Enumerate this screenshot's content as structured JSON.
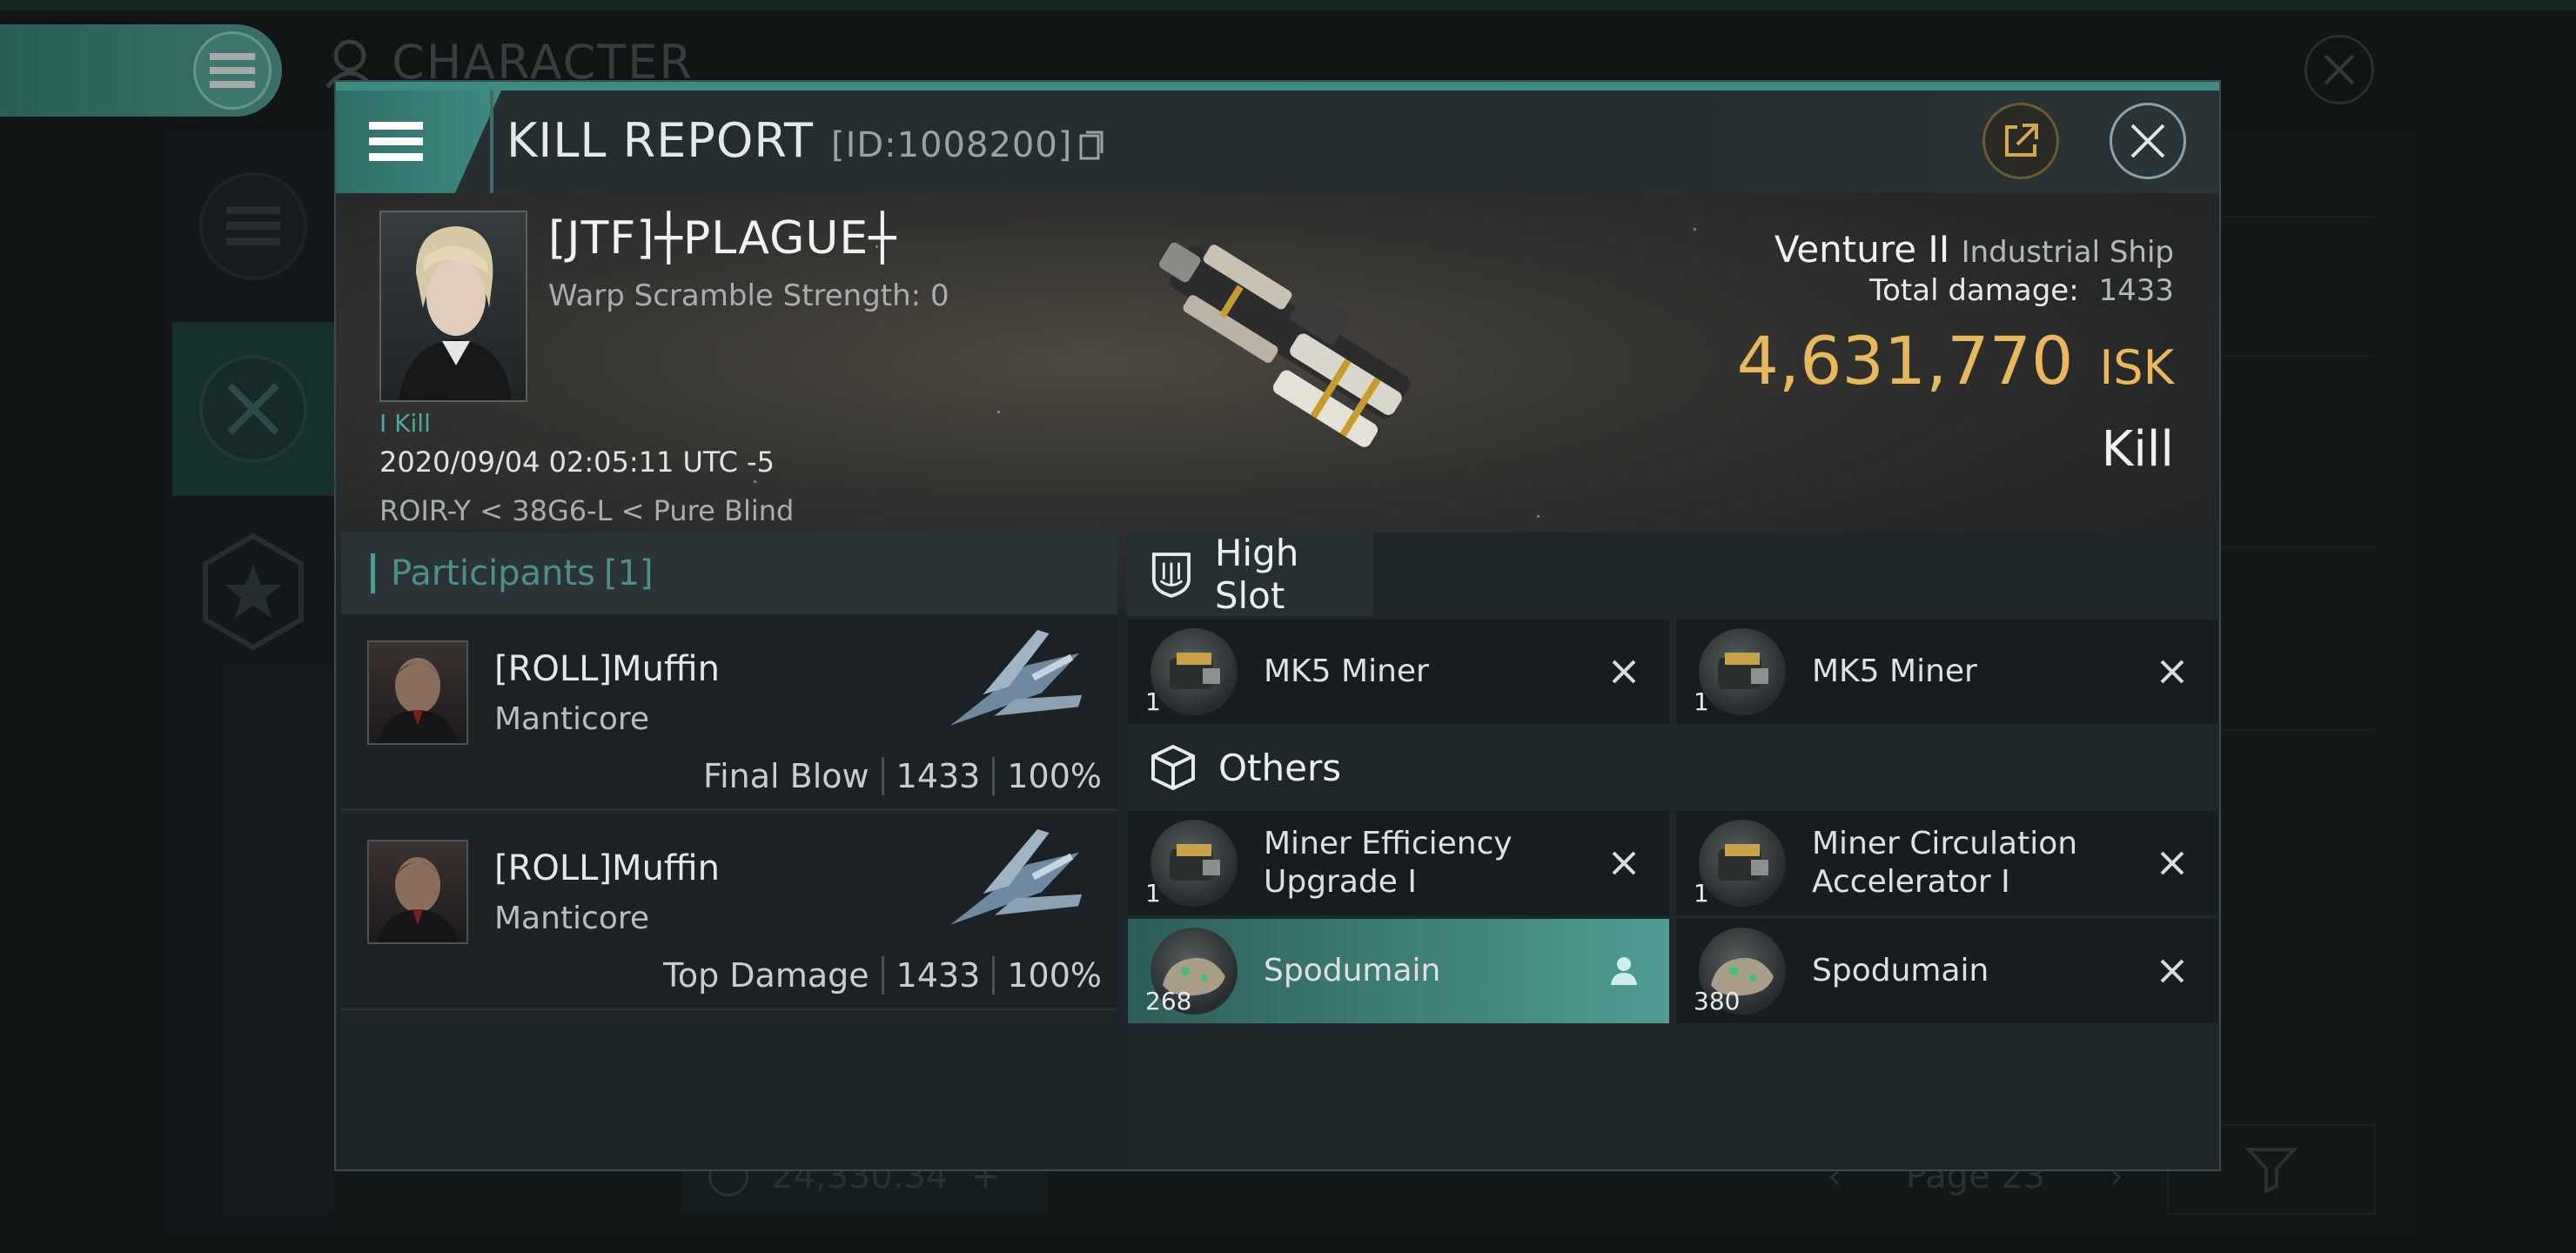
{
  "background": {
    "title": "CHARACTER",
    "amount": "24,330.34",
    "page": "Page 23"
  },
  "dialog": {
    "title": "KILL REPORT",
    "id": "[ID:1008200]"
  },
  "victim": {
    "name": "[JTF]┼PLAGUE┼",
    "warp_scramble": "Warp Scramble Strength: 0",
    "kills": "I Kill",
    "timestamp": "2020/09/04 02:05:11 UTC -5",
    "location": "ROIR-Y < 38G6-L < Pure Blind",
    "ship": "Venture II",
    "ship_class": "Industrial Ship",
    "damage_label": "Total damage:",
    "damage_value": "1433",
    "isk_value": "4,631,770",
    "isk_unit": "ISK",
    "result": "Kill"
  },
  "participants": {
    "label": "Participants",
    "count": "[1]",
    "rows": [
      {
        "name": "[ROLL]Muffin",
        "ship": "Manticore",
        "role": "Final Blow",
        "damage": "1433",
        "percent": "100%"
      },
      {
        "name": "[ROLL]Muffin",
        "ship": "Manticore",
        "role": "Top Damage",
        "damage": "1433",
        "percent": "100%"
      }
    ]
  },
  "modules": {
    "high_slot_label": "High Slot",
    "others_label": "Others",
    "high_slot": [
      {
        "name": "MK5 Miner",
        "qty": "1"
      },
      {
        "name": "MK5 Miner",
        "qty": "1"
      }
    ],
    "others": [
      {
        "name_line1": "Miner Efficiency",
        "name_line2": "Upgrade I",
        "qty": "1"
      },
      {
        "name_line1": "Miner Circulation",
        "name_line2": "Accelerator I",
        "qty": "1"
      },
      {
        "name": "Spodumain",
        "qty": "268",
        "highlighted": true
      },
      {
        "name": "Spodumain",
        "qty": "380"
      }
    ]
  },
  "colors": {
    "accent": "#4d9d93",
    "isk": "#e8b85a",
    "panel": "#1d2427"
  },
  "icons": [
    "menu-icon",
    "share-icon",
    "close-icon",
    "high-slot-icon",
    "cargo-box-icon",
    "destroyed-x-icon",
    "dropped-person-icon",
    "filter-icon"
  ]
}
